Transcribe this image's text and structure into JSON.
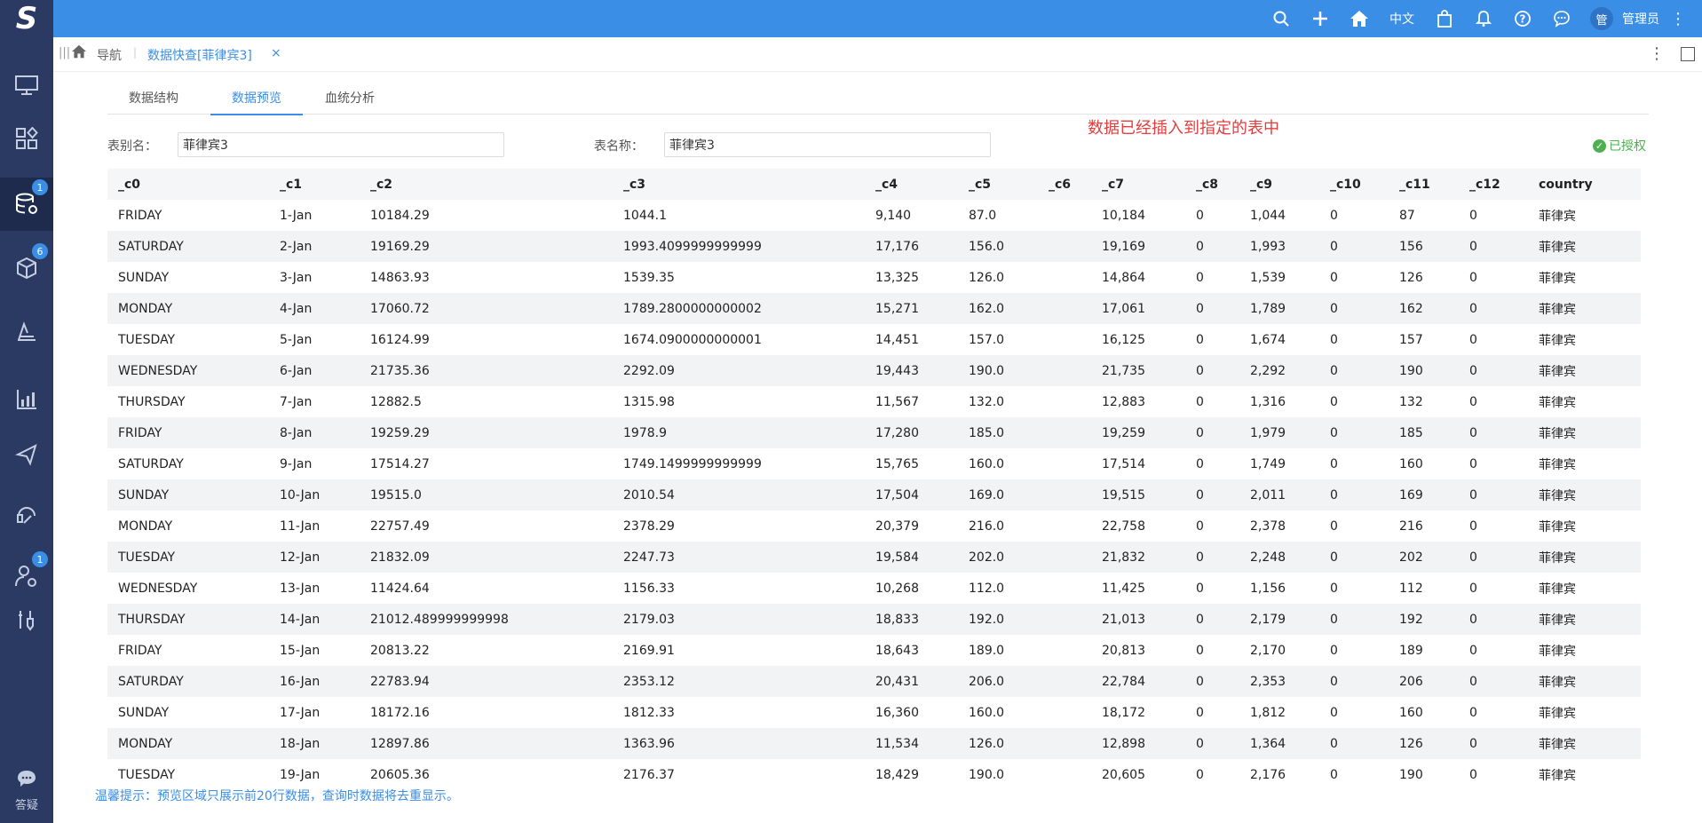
{
  "topbar": {
    "logo": "S",
    "icons": [
      "search-icon",
      "plus-icon",
      "home-icon"
    ],
    "lang": "中文",
    "icons_right": [
      "bag-icon",
      "bell-icon",
      "help-icon",
      "chat-icon"
    ],
    "avatar": "管",
    "username": "管理员",
    "more": "⋮"
  },
  "sidebar": {
    "items": [
      {
        "icon": "monitor-icon",
        "glyph": "🖥",
        "badge": ""
      },
      {
        "icon": "apps-icon",
        "glyph": "❖",
        "badge": ""
      },
      {
        "icon": "database-icon",
        "glyph": "⛁",
        "badge": "1"
      },
      {
        "icon": "cube-icon",
        "glyph": "⬡",
        "badge": "6"
      },
      {
        "icon": "layers-icon",
        "glyph": "⟁",
        "badge": ""
      },
      {
        "icon": "chart-icon",
        "glyph": "▥",
        "badge": ""
      },
      {
        "icon": "send-icon",
        "glyph": "➤",
        "badge": ""
      },
      {
        "icon": "support-icon",
        "glyph": "☊",
        "badge": ""
      },
      {
        "icon": "user-settings-icon",
        "glyph": "⚙",
        "badge": "1"
      },
      {
        "icon": "tools-icon",
        "glyph": "✂",
        "badge": ""
      }
    ],
    "help_label": "答疑"
  },
  "tabbar": {
    "grip": "|||",
    "nav_label": "导航",
    "sep": "|",
    "tab_label": "数据快查[菲律宾3]",
    "close": "×",
    "more": "⋮"
  },
  "subtabs": [
    "数据结构",
    "数据预览",
    "血统分析"
  ],
  "form": {
    "alias_label": "表别名：",
    "alias_value": "菲律宾3",
    "name_label": "表名称：",
    "name_value": "菲律宾3"
  },
  "notice": "数据已经插入到指定的表中",
  "auth": {
    "check": "✓",
    "label": "已授权"
  },
  "table": {
    "columns": [
      "_c0",
      "_c1",
      "_c2",
      "_c3",
      "_c4",
      "_c5",
      "_c6",
      "_c7",
      "_c8",
      "_c9",
      "_c10",
      "_c11",
      "_c12",
      "country"
    ],
    "rows": [
      [
        "FRIDAY",
        "1-Jan",
        "10184.29",
        "1044.1",
        "9,140",
        "87.0",
        "",
        "10,184",
        "0",
        "1,044",
        "0",
        "87",
        "0",
        "菲律宾"
      ],
      [
        "SATURDAY",
        "2-Jan",
        "19169.29",
        "1993.4099999999999",
        "17,176",
        "156.0",
        "",
        "19,169",
        "0",
        "1,993",
        "0",
        "156",
        "0",
        "菲律宾"
      ],
      [
        "SUNDAY",
        "3-Jan",
        "14863.93",
        "1539.35",
        "13,325",
        "126.0",
        "",
        "14,864",
        "0",
        "1,539",
        "0",
        "126",
        "0",
        "菲律宾"
      ],
      [
        "MONDAY",
        "4-Jan",
        "17060.72",
        "1789.2800000000002",
        "15,271",
        "162.0",
        "",
        "17,061",
        "0",
        "1,789",
        "0",
        "162",
        "0",
        "菲律宾"
      ],
      [
        "TUESDAY",
        "5-Jan",
        "16124.99",
        "1674.0900000000001",
        "14,451",
        "157.0",
        "",
        "16,125",
        "0",
        "1,674",
        "0",
        "157",
        "0",
        "菲律宾"
      ],
      [
        "WEDNESDAY",
        "6-Jan",
        "21735.36",
        "2292.09",
        "19,443",
        "190.0",
        "",
        "21,735",
        "0",
        "2,292",
        "0",
        "190",
        "0",
        "菲律宾"
      ],
      [
        "THURSDAY",
        "7-Jan",
        "12882.5",
        "1315.98",
        "11,567",
        "132.0",
        "",
        "12,883",
        "0",
        "1,316",
        "0",
        "132",
        "0",
        "菲律宾"
      ],
      [
        "FRIDAY",
        "8-Jan",
        "19259.29",
        "1978.9",
        "17,280",
        "185.0",
        "",
        "19,259",
        "0",
        "1,979",
        "0",
        "185",
        "0",
        "菲律宾"
      ],
      [
        "SATURDAY",
        "9-Jan",
        "17514.27",
        "1749.1499999999999",
        "15,765",
        "160.0",
        "",
        "17,514",
        "0",
        "1,749",
        "0",
        "160",
        "0",
        "菲律宾"
      ],
      [
        "SUNDAY",
        "10-Jan",
        "19515.0",
        "2010.54",
        "17,504",
        "169.0",
        "",
        "19,515",
        "0",
        "2,011",
        "0",
        "169",
        "0",
        "菲律宾"
      ],
      [
        "MONDAY",
        "11-Jan",
        "22757.49",
        "2378.29",
        "20,379",
        "216.0",
        "",
        "22,758",
        "0",
        "2,378",
        "0",
        "216",
        "0",
        "菲律宾"
      ],
      [
        "TUESDAY",
        "12-Jan",
        "21832.09",
        "2247.73",
        "19,584",
        "202.0",
        "",
        "21,832",
        "0",
        "2,248",
        "0",
        "202",
        "0",
        "菲律宾"
      ],
      [
        "WEDNESDAY",
        "13-Jan",
        "11424.64",
        "1156.33",
        "10,268",
        "112.0",
        "",
        "11,425",
        "0",
        "1,156",
        "0",
        "112",
        "0",
        "菲律宾"
      ],
      [
        "THURSDAY",
        "14-Jan",
        "21012.489999999998",
        "2179.03",
        "18,833",
        "192.0",
        "",
        "21,013",
        "0",
        "2,179",
        "0",
        "192",
        "0",
        "菲律宾"
      ],
      [
        "FRIDAY",
        "15-Jan",
        "20813.22",
        "2169.91",
        "18,643",
        "189.0",
        "",
        "20,813",
        "0",
        "2,170",
        "0",
        "189",
        "0",
        "菲律宾"
      ],
      [
        "SATURDAY",
        "16-Jan",
        "22783.94",
        "2353.12",
        "20,431",
        "206.0",
        "",
        "22,784",
        "0",
        "2,353",
        "0",
        "206",
        "0",
        "菲律宾"
      ],
      [
        "SUNDAY",
        "17-Jan",
        "18172.16",
        "1812.33",
        "16,360",
        "160.0",
        "",
        "18,172",
        "0",
        "1,812",
        "0",
        "160",
        "0",
        "菲律宾"
      ],
      [
        "MONDAY",
        "18-Jan",
        "12897.86",
        "1363.96",
        "11,534",
        "126.0",
        "",
        "12,898",
        "0",
        "1,364",
        "0",
        "126",
        "0",
        "菲律宾"
      ],
      [
        "TUESDAY",
        "19-Jan",
        "20605.36",
        "2176.37",
        "18,429",
        "190.0",
        "",
        "20,605",
        "0",
        "2,176",
        "0",
        "190",
        "0",
        "菲律宾"
      ]
    ]
  },
  "tip": "温馨提示：预览区域只展示前20行数据，查询时数据将去重显示。"
}
